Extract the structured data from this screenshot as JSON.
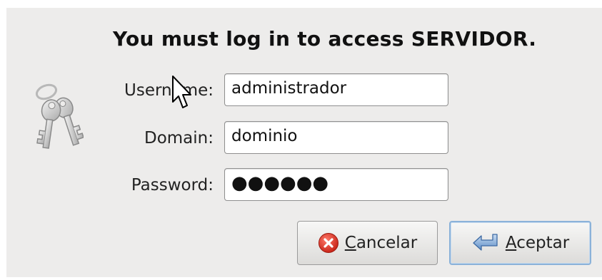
{
  "dialog": {
    "title": "You must log in to access SERVIDOR.",
    "icon": "keys-icon",
    "fields": {
      "username": {
        "label": "Username:",
        "value": "administrador"
      },
      "domain": {
        "label": "Domain:",
        "value": "dominio"
      },
      "password": {
        "label": "Password:",
        "value": "●●●●●●"
      }
    },
    "buttons": {
      "cancel": {
        "icon": "cancel-icon",
        "mnemonic": "C",
        "rest": "ancelar"
      },
      "ok": {
        "icon": "enter-arrow-icon",
        "mnemonic": "A",
        "rest": "ceptar"
      }
    }
  },
  "colors": {
    "dialog_bg": "#edeceb",
    "focus_border": "#8bb2d9",
    "cancel_red": "#d82c1f"
  }
}
